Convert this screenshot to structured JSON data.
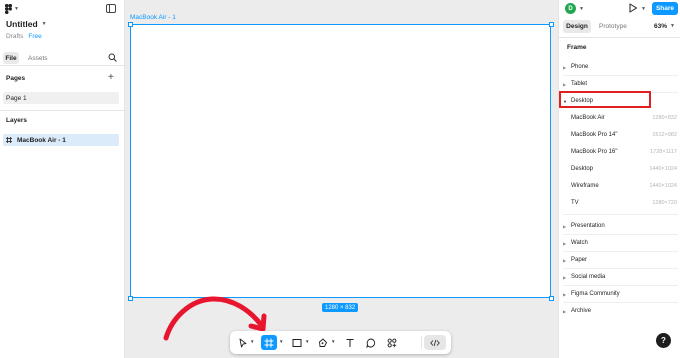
{
  "left_panel": {
    "file_title": "Untitled",
    "drafts_label": "Drafts",
    "plan_label": "Free",
    "tabs": {
      "file": "File",
      "assets": "Assets"
    },
    "pages_heading": "Pages",
    "pages": [
      "Page 1"
    ],
    "layers_heading": "Layers",
    "layers": [
      "MacBook Air - 1"
    ]
  },
  "canvas": {
    "frame_label": "MacBook Air - 1",
    "frame_dimensions": "1280 × 832",
    "selection_color": "#0d99ff",
    "annotation_color": "#e8152f"
  },
  "toolbar": {
    "tools": [
      "move-tool",
      "frame-tool",
      "shape-tool",
      "pen-tool",
      "text-tool",
      "comment-tool",
      "actions-tool",
      "dev-mode-toggle"
    ],
    "active_tool": "frame-tool"
  },
  "right_panel": {
    "avatar_initial": "D",
    "share_label": "Share",
    "tabs": {
      "design": "Design",
      "prototype": "Prototype"
    },
    "zoom": "63%",
    "frame_heading": "Frame",
    "categories_top": [
      "Phone",
      "Tablet"
    ],
    "expanded_category": "Desktop",
    "desktop_presets": [
      {
        "name": "MacBook Air",
        "size": "1280×832"
      },
      {
        "name": "MacBook Pro 14\"",
        "size": "1512×982"
      },
      {
        "name": "MacBook Pro 16\"",
        "size": "1728×1117"
      },
      {
        "name": "Desktop",
        "size": "1440×1024"
      },
      {
        "name": "Wireframe",
        "size": "1440×1024"
      },
      {
        "name": "TV",
        "size": "1280×720"
      }
    ],
    "categories_bottom": [
      "Presentation",
      "Watch",
      "Paper",
      "Social media",
      "Figma Community",
      "Archive"
    ],
    "help_label": "?"
  }
}
